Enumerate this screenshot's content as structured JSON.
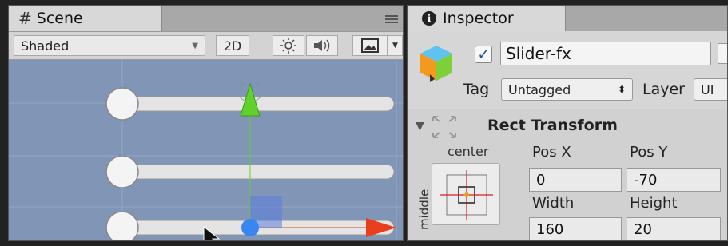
{
  "scene": {
    "tab_label": "Scene",
    "shading_mode": "Shaded",
    "mode_2d": "2D",
    "icons": [
      "hash-icon",
      "menu-icon",
      "sun-icon",
      "speaker-icon",
      "image-icon"
    ]
  },
  "inspector": {
    "tab_label": "Inspector",
    "gameobject": {
      "active": true,
      "name": "Slider-fx",
      "tag_label": "Tag",
      "tag_value": "Untagged",
      "layer_label": "Layer",
      "layer_value": "UI"
    },
    "rect_transform": {
      "title": "Rect Transform",
      "anchor_horizontal": "center",
      "anchor_vertical": "middle",
      "pos_x_label": "Pos X",
      "pos_y_label": "Pos Y",
      "pos_x": "0",
      "pos_y": "-70",
      "width_label": "Width",
      "height_label": "Height",
      "width": "160",
      "height": "20"
    }
  },
  "colors": {
    "viewport_bg": "#8195b7",
    "gizmo_x": "#e8401c",
    "gizmo_y": "#5fd02c",
    "gizmo_center": "#3a86f0",
    "anchor_cross": "#d21f1f"
  }
}
